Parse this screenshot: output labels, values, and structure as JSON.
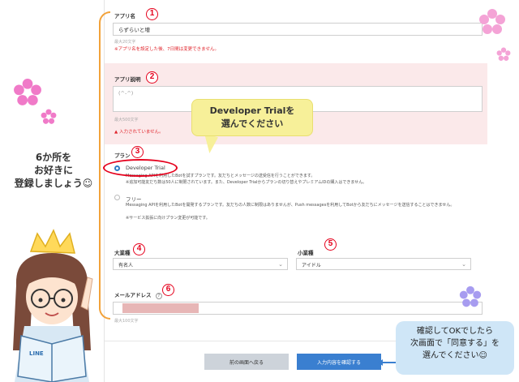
{
  "form": {
    "app_name_label": "アプリ名",
    "app_name_value": "らずらいと増",
    "app_name_hint": "最大20文字",
    "app_name_warning": "※アプリ名を設定した後、7日間は変更できません。",
    "app_desc_label": "アプリ説明",
    "app_desc_value": "(^-^)",
    "app_desc_hint": "最大500文字",
    "app_desc_error": "▲ 入力されていません。",
    "plan_label": "プラン",
    "plans": [
      {
        "title": "Developer Trial",
        "desc1": "Messaging APIを利用したBotを試すプランです。友だちとメッセージの送受信を行うことができます。",
        "desc2": "※追加可能友だち数は50人に制限されています。また、Developer Trialからプランの切り替えやプレミアムIDの購入はできません。",
        "selected": true
      },
      {
        "title": "フリー",
        "desc1": "Messaging APIを利用したBotを開発するプランです。友だちの人数に制限はありませんが、Push messagesを利用してBotから友だちにメッセージを送信することはできません。",
        "desc2": "※サービス拡張に向けプラン変更が可能です。",
        "selected": false
      }
    ],
    "category_label": "大業種",
    "category_value": "有名人",
    "subcategory_label": "小業種",
    "subcategory_value": "アイドル",
    "email_label": "メールアドレス",
    "email_hint": "最大100文字",
    "back_button": "前の画面へ戻る",
    "confirm_button": "入力内容を確認する"
  },
  "annotations": {
    "numbers": [
      "1",
      "2",
      "3",
      "4",
      "5",
      "6"
    ],
    "bubble_line1": "Developer Trialを",
    "bubble_line2": "選んでください",
    "left_line1": "6か所を",
    "left_line2": "お好きに",
    "left_line3": "登録しましょう☺",
    "note_line1": "確認してOKでしたら",
    "note_line2": "次画面で「同意する」を",
    "note_line3": "選んでください☺",
    "book_text": "LINE"
  },
  "colors": {
    "accent_red": "#e5001c",
    "primary_blue": "#3a7fd0",
    "bracket_orange": "#f2a23a",
    "bubble_yellow": "#f7f099",
    "note_blue": "#cfe6f7",
    "error_pink": "#fbe9ea"
  }
}
